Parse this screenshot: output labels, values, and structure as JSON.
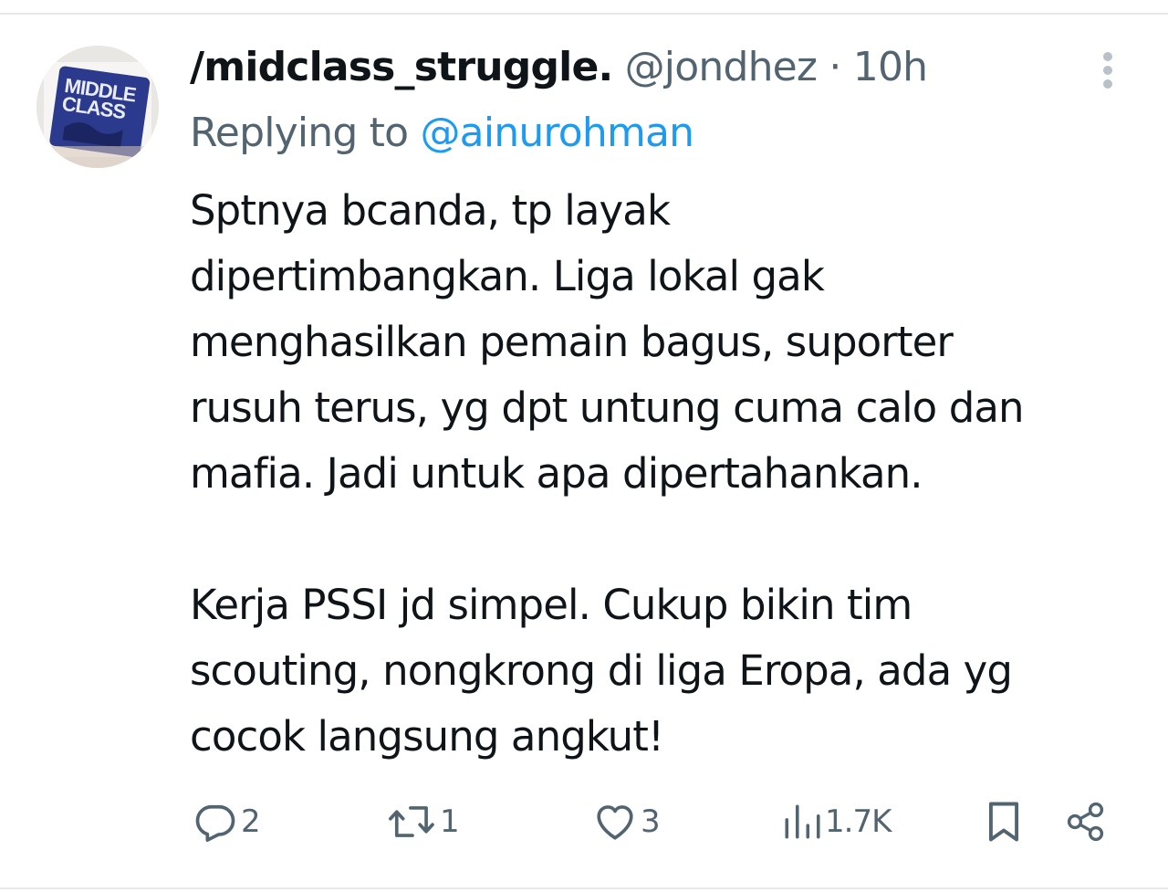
{
  "tweet": {
    "display_name": "/midclass_struggle.",
    "handle": "@jondhez",
    "separator": "·",
    "time": "10h",
    "replying_prefix": "Replying to",
    "reply_to": "@ainurohman",
    "avatar_text_line1": "MIDDLE",
    "avatar_text_line2": "CLASS",
    "text_lines": [
      "Sptnya bcanda, tp layak",
      "dipertimbangkan. Liga lokal gak",
      "menghasilkan pemain bagus, suporter",
      "rusuh terus, yg dpt untung cuma calo dan",
      "mafia. Jadi untuk apa dipertahankan.",
      "Kerja PSSI jd simpel. Cukup bikin tim",
      "scouting, nongkrong di liga Eropa, ada yg",
      "cocok langsung angkut!"
    ]
  },
  "actions": {
    "replies": "2",
    "retweets": "1",
    "likes": "3",
    "views": "1.7K"
  },
  "colors": {
    "text": "#0f1419",
    "secondary": "#536471",
    "link": "#1d9bf0",
    "divider": "#e7e9ea"
  },
  "icons": {
    "reply": "reply-icon",
    "retweet": "retweet-icon",
    "like": "heart-icon",
    "views": "views-icon",
    "bookmark": "bookmark-icon",
    "share": "share-icon",
    "more": "more-icon"
  }
}
